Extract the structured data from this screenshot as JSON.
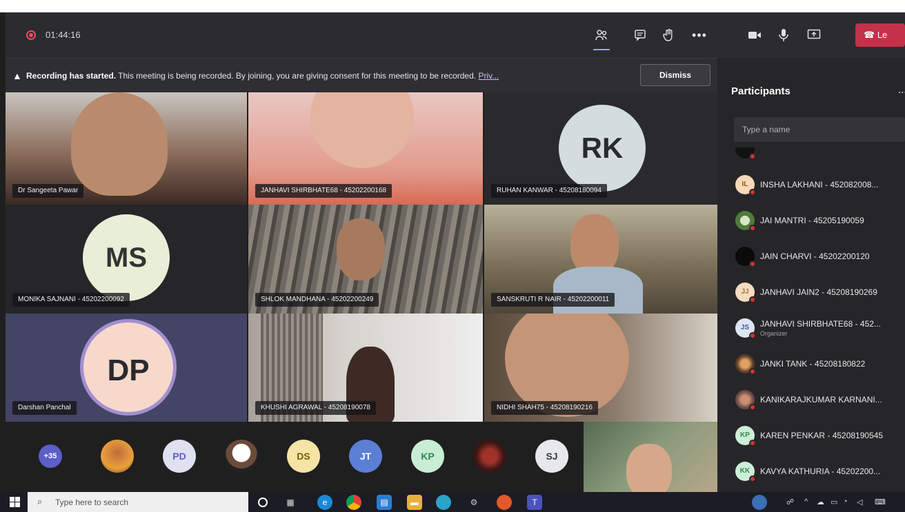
{
  "meeting": {
    "timer": "01:44:16",
    "controls": {
      "participants_icon": "people-icon",
      "chat_icon": "chat-icon",
      "raise_hand_icon": "hand-icon",
      "more_icon": "ellipsis-icon",
      "camera_icon": "video-camera-icon",
      "mic_icon": "microphone-icon",
      "share_icon": "share-screen-icon",
      "leave_label": "Le"
    }
  },
  "banner": {
    "title": "Recording has started.",
    "message": "This meeting is being recorded. By joining, you are giving consent for this meeting to be recorded.",
    "link": "Priv...",
    "dismiss_label": "Dismiss"
  },
  "tiles": [
    {
      "name": "Dr Sangeeta Pawar"
    },
    {
      "name": "JANHAVI SHIRBHATE68 - 45202200168"
    },
    {
      "name": "RUHAN KANWAR - 45208180094",
      "initials": "RK"
    },
    {
      "name": "MONIKA SAJNANI - 45202200092",
      "initials": "MS"
    },
    {
      "name": "SHLOK MANDHANA - 45202200249"
    },
    {
      "name": "SANSKRUTI R NAIR - 45202200011"
    },
    {
      "name": "Darshan Panchal",
      "initials": "DP"
    },
    {
      "name": "KHUSHI AGRAWAL - 45208190078"
    },
    {
      "name": "NIDHI SHAH75 - 45208190216"
    }
  ],
  "strip": {
    "overflow": "+35",
    "avatars": [
      "PD",
      "DS",
      "JT",
      "KP",
      "SJ"
    ]
  },
  "panel": {
    "title": "Participants",
    "more": "...",
    "search_placeholder": "Type a name",
    "participants": [
      {
        "name": "INSHA LAKHANI - 452082008...",
        "initials": "IL"
      },
      {
        "name": "JAI MANTRI - 45205190059",
        "initials": ""
      },
      {
        "name": "JAIN CHARVI - 45202200120",
        "initials": ""
      },
      {
        "name": "JANHAVI JAIN2 - 45208190269",
        "initials": "JJ"
      },
      {
        "name": "JANHAVI SHIRBHATE68 - 452...",
        "initials": "JS",
        "role": "Organizer"
      },
      {
        "name": "JANKI TANK - 45208180822",
        "initials": ""
      },
      {
        "name": "KANIKARAJKUMAR KARNANI...",
        "initials": ""
      },
      {
        "name": "KAREN PENKAR - 45208190545",
        "initials": "KP"
      },
      {
        "name": "KAVYA KATHURIA - 45202200...",
        "initials": "KK"
      }
    ]
  },
  "taskbar": {
    "search_placeholder": "Type here to search"
  },
  "colors": {
    "accent": "#6264a7",
    "leave": "#c4314b",
    "status_busy": "#d13438",
    "recording": "#e8505b"
  }
}
